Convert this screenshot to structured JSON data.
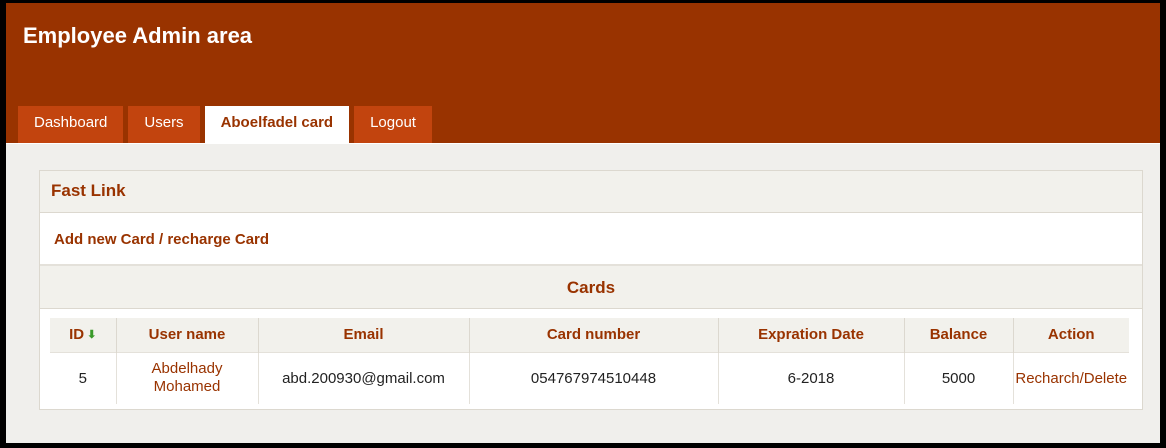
{
  "header": {
    "title": "Employee Admin area"
  },
  "tabs": [
    {
      "label": "Dashboard",
      "active": false
    },
    {
      "label": "Users",
      "active": false
    },
    {
      "label": "Aboelfadel card",
      "active": true
    },
    {
      "label": "Logout",
      "active": false
    }
  ],
  "fast_link": {
    "title": "Fast Link",
    "link_label": "Add new Card / recharge Card"
  },
  "cards": {
    "title": "Cards",
    "columns": [
      "ID",
      "User name",
      "Email",
      "Card number",
      "Expration Date",
      "Balance",
      "Action"
    ],
    "sort_icon": "arrow-down-icon",
    "rows": [
      {
        "id": "5",
        "user_name_line1": "Abdelhady",
        "user_name_line2": "Mohamed",
        "email": "abd.200930@gmail.com",
        "card_number": "054767974510448",
        "expiration": "6-2018",
        "balance": "5000",
        "action": "Recharch/Delete"
      }
    ]
  },
  "colors": {
    "brand": "#993300",
    "tab": "#c2440e",
    "sort_arrow": "#3a9a2a"
  }
}
